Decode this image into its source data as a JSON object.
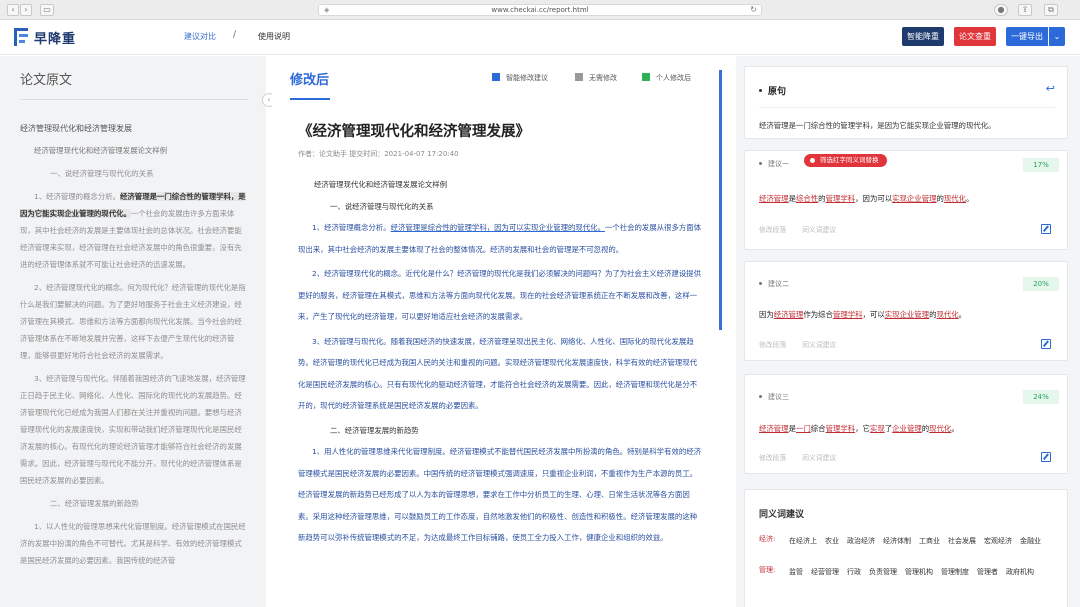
{
  "browser": {
    "url": "www.checkai.cc/report.html"
  },
  "header": {
    "logo_text": "早降重",
    "nav": [
      "建议对比",
      "使用说明"
    ],
    "nav_separator": "/",
    "buttons": {
      "smart": "智能降重",
      "paper": "论文查重",
      "export": "一键导出"
    },
    "colors": {
      "smart": "#1f3b6e",
      "paper": "#e0353b",
      "export": "#2b6ad8"
    }
  },
  "left_panel": {
    "title": "论文原文",
    "heading": "经济管理现代化和经济管理发展",
    "subheading": "经济管理现代化和经济管理发展论文样例",
    "section1": "一、说经济管理与现代化的关系",
    "p1_pre": "1、经济管理的概念分析。",
    "p1_hl": "经济管理是一门综合性的管理学科，是因为它能实现企业管理的现代化。",
    "p1_post": "一个社会的发展由许多方面来体现，其中社会经济的发展是主要体现社会的总体状况。社会经济要能经济管理来实现，经济管理在社会经济发展中的角色很重要，没有先进的经济管理体系就不可能让社会经济的迅速发展。",
    "p2": "2、经济管理现代化的概念。何为现代化？经济管理的现代化是指什么是我们要解决的问题。为了更好地服务于社会主义经济建设，经济管理在其模式、思维和方法等方面都向现代化发展。当今社会的经济管理体系在不断地发展并完善，这样下去便产生现代化的经济管理，能够很更好地符合社会经济的发展需求。",
    "p3": "3、经济管理与现代化。伴随着我国经济的飞速地发展，经济管理正日趋于民主化、网络化、人性化、国际化的现代化的发展趋势。经济管理现代化已经成为我国人们都在关注并重视的问题。要想与经济管理现代化的发展速度快，实现和带动我们经济管理现代化是国民经济发展的核心。有现代化的理论经济管理才能够符合社会经济的发展需求。因此，经济管理与现代化不能分开，现代化的经济管理体系是国民经济发展的必要因素。",
    "section2": "二、经济管理发展的新趋势",
    "p4": "1、以人性化的管理思想来代化管理制度。经济管理模式在国民经济的发展中扮演的角色不可替代。尤其是科学、有效的经济管理模式是国民经济发展的必要因素。我国传统的经济管"
  },
  "middle_panel": {
    "tab": "修改后",
    "legend": [
      {
        "label": "智能修改建议",
        "color": "#2b6ad8"
      },
      {
        "label": "无需修改",
        "color": "#999999"
      },
      {
        "label": "个人修改后",
        "color": "#2fb053"
      }
    ],
    "doc_title": "《经济管理现代化和经济管理发展》",
    "meta": "作者：论文助手    提交时间：2021-04-07 17:20:40",
    "subtitle": "经济管理现代化和经济管理发展论文样例",
    "section1": "一、说经济管理与现代化的关系",
    "p1_pre": "1、经济管理概念分析。",
    "p1_ul": "经济管理是综合性的管理学科，因为可以实现企业管理的现代化。",
    "p1_post": "一个社会的发展从很多方面体现出来，其中社会经济的发展主要体现了社会的整体情况。经济的发展和社会的管理是不可忽视的。",
    "p2": "2、经济管理现代化的概念。近代化是什么？经济管理的现代化是我们必须解决的问题吗？为了为社会主义经济建设提供更好的服务，经济管理在其模式，思维和方法等方面向现代化发展。现在的社会经济管理系统正在不断发展和改善，这样一来，产生了现代化的经济管理，可以更好地适应社会经济的发展需求。",
    "p3": "3、经济管理与现代化。随着我国经济的快速发展，经济管理呈现出民主化、网络化、人性化、国际化的现代化发展趋势。经济管理的现代化已经成为我国人民的关注和重视的问题。实现经济管理现代化发展速度快，科学有效的经济管理现代化是国民经济发展的核心。只有有现代化的驱动经济管理，才能符合社会经济的发展需要。因此，经济管理和现代化是分不开的，现代的经济管理系统是国民经济发展的必要因素。",
    "section2": "二、经济管理发展的新趋势",
    "p4": "1、用人性化的管理思维来代化管理制度。经济管理模式不能替代国民经济发展中所扮演的角色。特别是科学有效的经济管理模式是国民经济发展的必要因素。中国传统的经济管理模式强调速度，只重视企业利润，不重视作为生产本源的员工。经济管理发展的新趋势已经形成了以人为本的管理思想，要求在工作中分析员工的生理、心理、日常生活状况等各方面因素。采用这种经济管理思维，可以鼓励员工的工作态度，自然地激发他们的积极性、创造性和积极性。经济管理发展的这种新趋势可以弥补传统管理模式的不足，为达成最终工作目标铺路，使员工全力投入工作，健康企业和组织的效益。"
  },
  "right_panel": {
    "original": {
      "title": "原句",
      "text": "经济管理是一门综合性的管理学科，是因为它能实现企业管理的现代化。"
    },
    "suggestions": [
      {
        "label": "建议一",
        "tag": "筛选红字同义词替换",
        "pct": "17%",
        "segments": [
          {
            "t": "经济管理",
            "r": true
          },
          {
            "t": "是",
            "r": false
          },
          {
            "t": "综合性",
            "r": true
          },
          {
            "t": "的",
            "r": false
          },
          {
            "t": "管理学科",
            "r": true
          },
          {
            "t": "，因为可以",
            "r": false
          },
          {
            "t": "实现企业管理",
            "r": true
          },
          {
            "t": "的",
            "r": false
          },
          {
            "t": "现代化",
            "r": true
          },
          {
            "t": "。",
            "r": false
          }
        ],
        "ops": [
          "修改段落",
          "同义词建议"
        ]
      },
      {
        "label": "建议二",
        "pct": "20%",
        "segments": [
          {
            "t": "因为",
            "r": false
          },
          {
            "t": "经济管理",
            "r": true
          },
          {
            "t": "作为综合",
            "r": false
          },
          {
            "t": "管理学科",
            "r": true
          },
          {
            "t": "，可以",
            "r": false
          },
          {
            "t": "实现企业管理",
            "r": true
          },
          {
            "t": "的",
            "r": false
          },
          {
            "t": "现代化",
            "r": true
          },
          {
            "t": "。",
            "r": false
          }
        ],
        "ops": [
          "修改段落",
          "同义词建议"
        ]
      },
      {
        "label": "建议三",
        "pct": "24%",
        "segments": [
          {
            "t": "经济管理",
            "r": true
          },
          {
            "t": "是",
            "r": false
          },
          {
            "t": "一门",
            "r": true
          },
          {
            "t": "综合",
            "r": false
          },
          {
            "t": "管理学科",
            "r": true
          },
          {
            "t": "，它",
            "r": false
          },
          {
            "t": "实现",
            "r": true
          },
          {
            "t": "了",
            "r": false
          },
          {
            "t": "企业管理",
            "r": true
          },
          {
            "t": "的",
            "r": false
          },
          {
            "t": "现代化",
            "r": true
          },
          {
            "t": "。",
            "r": false
          }
        ],
        "ops": [
          "修改段落",
          "同义词建议"
        ]
      }
    ],
    "synonyms": {
      "title": "同义词建议",
      "rows": [
        {
          "key": "经济:",
          "words": [
            "在经济上",
            "农业",
            "政治经济",
            "经济体制",
            "工商业",
            "社会发展",
            "宏观经济",
            "金融业"
          ]
        },
        {
          "key": "管理:",
          "words": [
            "监管",
            "经营管理",
            "行政",
            "负责管理",
            "管理机构",
            "管理制度",
            "管理者",
            "政府机构"
          ]
        }
      ]
    }
  }
}
